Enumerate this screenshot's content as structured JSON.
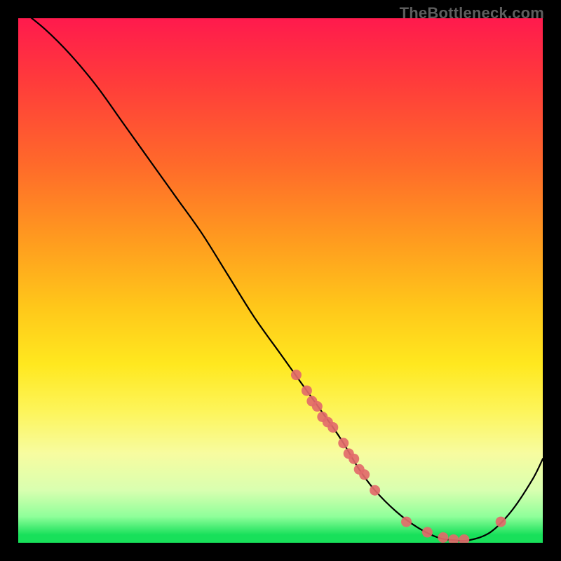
{
  "watermark": "TheBottleneck.com",
  "chart_data": {
    "type": "line",
    "title": "",
    "xlabel": "",
    "ylabel": "",
    "xlim": [
      0,
      100
    ],
    "ylim": [
      0,
      100
    ],
    "series": [
      {
        "name": "curve",
        "x": [
          0,
          5,
          10,
          15,
          20,
          25,
          30,
          35,
          40,
          45,
          50,
          55,
          60,
          62,
          65,
          68,
          72,
          76,
          80,
          83,
          86,
          90,
          94,
          98,
          100
        ],
        "y": [
          102,
          98,
          93,
          87,
          80,
          73,
          66,
          59,
          51,
          43,
          36,
          29,
          22,
          19,
          14,
          10,
          6,
          3,
          1,
          0.5,
          0.5,
          2,
          6,
          12,
          16
        ]
      }
    ],
    "markers": {
      "name": "highlight-points",
      "x": [
        53,
        55,
        56,
        57,
        58,
        59,
        60,
        62,
        63,
        64,
        65,
        66,
        68,
        74,
        78,
        81,
        83,
        85,
        92
      ],
      "y": [
        32,
        29,
        27,
        26,
        24,
        23,
        22,
        19,
        17,
        16,
        14,
        13,
        10,
        4,
        2,
        1,
        0.6,
        0.6,
        4
      ]
    }
  }
}
